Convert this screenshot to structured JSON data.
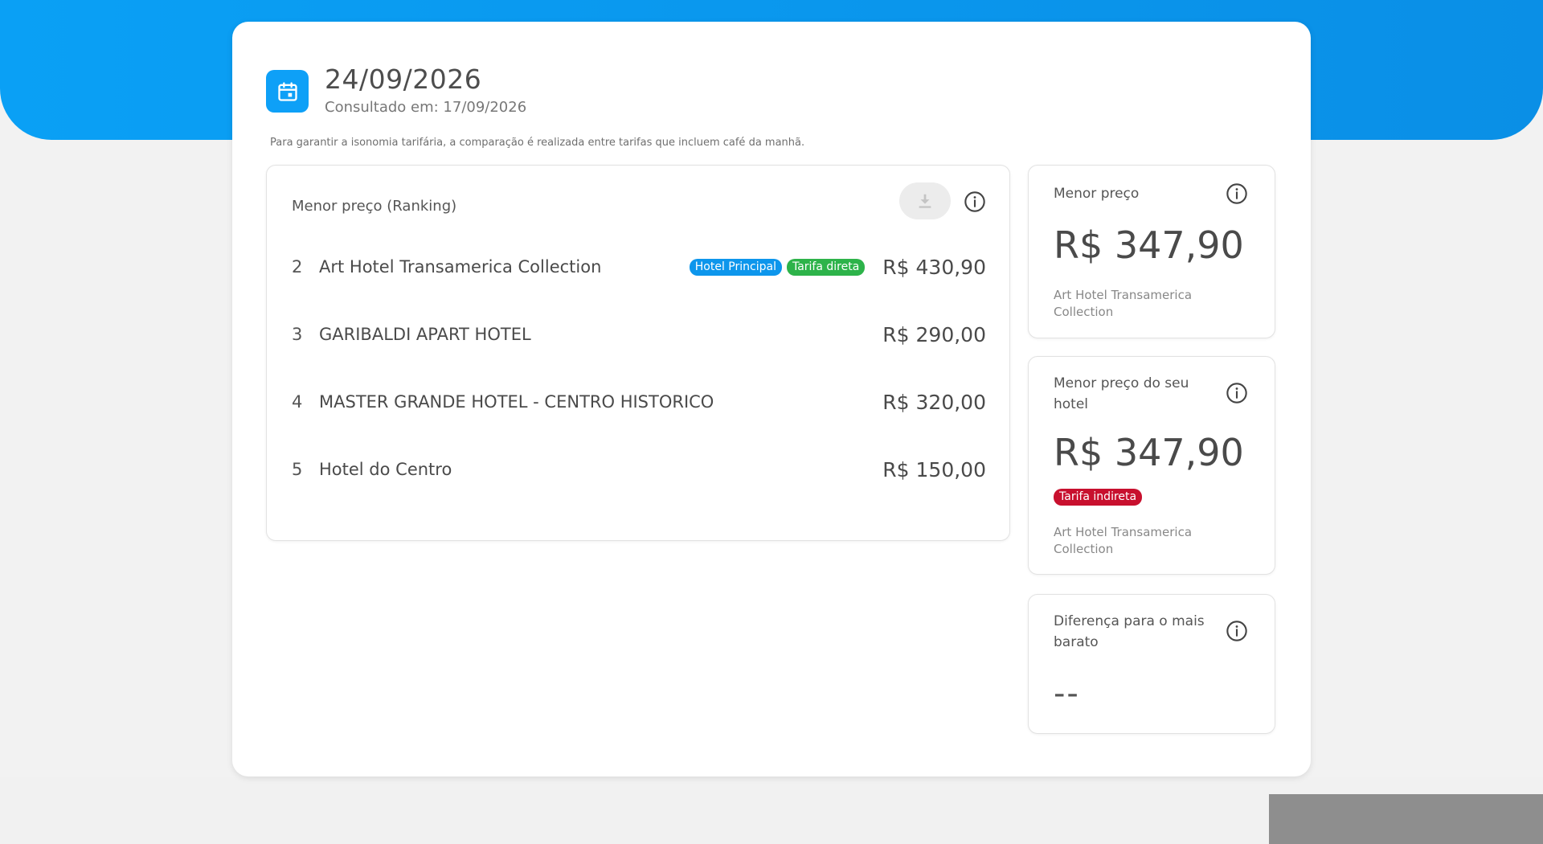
{
  "header": {
    "date": "24/09/2026",
    "consulted": "Consultado em: 17/09/2026",
    "note": "Para garantir a isonomia tarifária, a comparação é realizada entre tarifas que incluem café da manhã."
  },
  "ranking": {
    "title": "Menor preço (Ranking)",
    "rows": [
      {
        "rank": "2",
        "name": "Art Hotel Transamerica Collection",
        "price": "R$ 430,90",
        "badges": [
          {
            "label": "Hotel Principal",
            "color": "#0d96ec"
          },
          {
            "label": "Tarifa direta",
            "color": "#2db34a"
          }
        ]
      },
      {
        "rank": "3",
        "name": "GARIBALDI APART HOTEL",
        "price": "R$ 290,00",
        "badges": []
      },
      {
        "rank": "4",
        "name": "MASTER GRANDE HOTEL - CENTRO HISTORICO",
        "price": "R$ 320,00",
        "badges": []
      },
      {
        "rank": "5",
        "name": "Hotel do Centro",
        "price": "R$ 150,00",
        "badges": []
      }
    ]
  },
  "cards": {
    "lowest": {
      "title": "Menor preço",
      "price": "R$ 347,90",
      "hotel": "Art Hotel Transamerica Collection"
    },
    "your_hotel": {
      "title": "Menor preço do seu hotel",
      "price": "R$ 347,90",
      "badge": "Tarifa indireta",
      "badge_color": "#c8102e",
      "hotel": "Art Hotel Transamerica Collection"
    },
    "difference": {
      "title": "Diferença para o mais barato",
      "value": "--"
    }
  },
  "colors": {
    "accent": "#0ea0f7",
    "band": "#0a96ec"
  },
  "icons": {
    "date": "calendar-icon",
    "download": "download-icon",
    "info": "info-icon"
  }
}
